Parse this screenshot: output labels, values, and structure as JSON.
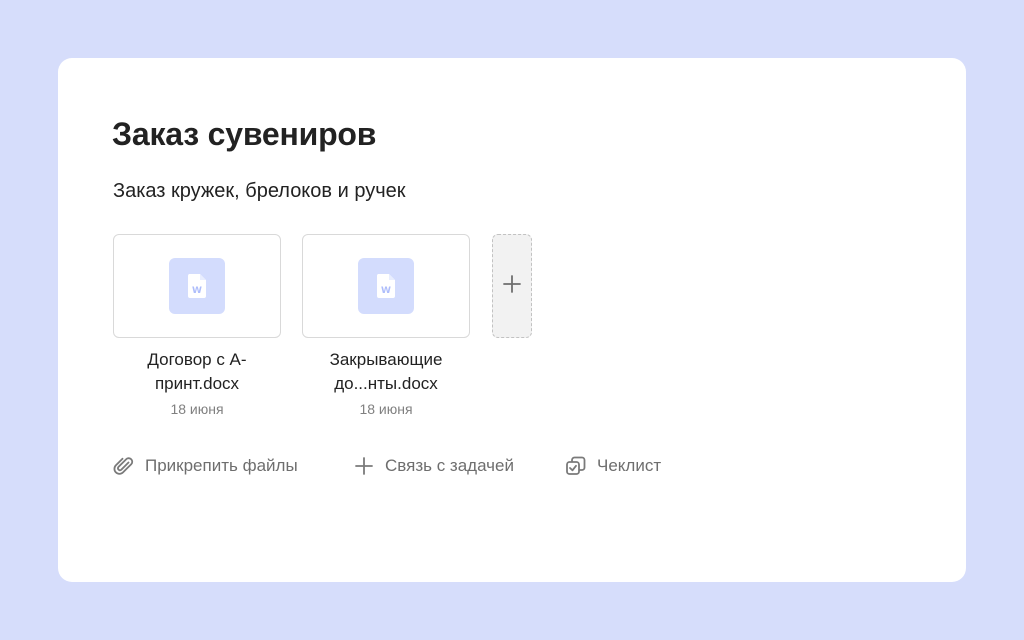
{
  "task": {
    "title": "Заказ сувениров",
    "description": "Заказ кружек, брелоков и ручек"
  },
  "attachments": [
    {
      "name_line1": "Договор с А-",
      "name_line2": "принт.docx",
      "date": "18 июня",
      "icon": "word-document-icon"
    },
    {
      "name_line1": "Закрывающие",
      "name_line2": "до...нты.docx",
      "date": "18 июня",
      "icon": "word-document-icon"
    }
  ],
  "add_attachment": {
    "icon": "plus-icon"
  },
  "actions": [
    {
      "label": "Прикрепить файлы",
      "icon": "paperclip-icon"
    },
    {
      "label": "Связь с задачей",
      "icon": "plus-icon"
    },
    {
      "label": "Чеклист",
      "icon": "checklist-icon"
    }
  ],
  "colors": {
    "page_background": "#d6ddfb",
    "card_background": "#ffffff",
    "doc_icon_background": "#d3dcfd",
    "doc_icon_foreground": "#ffffff",
    "primary_text": "#222222",
    "secondary_text": "#6e6e6e",
    "date_text": "#808080"
  }
}
